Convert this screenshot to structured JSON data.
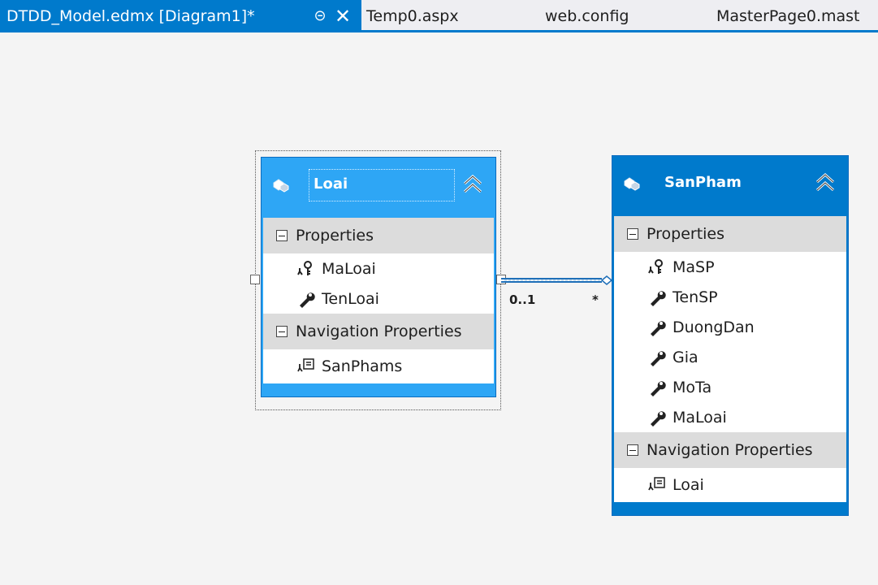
{
  "tabs": [
    {
      "label": "DTDD_Model.edmx [Diagram1]*",
      "active": true
    },
    {
      "label": "Temp0.aspx",
      "active": false
    },
    {
      "label": "web.config",
      "active": false
    },
    {
      "label": "MasterPage0.mast",
      "active": false
    }
  ],
  "tab_icons": {
    "pin": "pin-icon",
    "close": "close-icon"
  },
  "entities": {
    "loai": {
      "title": "Loai",
      "properties_header": "Properties",
      "properties": [
        {
          "name": "MaLoai",
          "icon": "key-property-icon"
        },
        {
          "name": "TenLoai",
          "icon": "property-wrench-icon"
        }
      ],
      "nav_header": "Navigation Properties",
      "nav_properties": [
        {
          "name": "SanPhams",
          "icon": "navigation-property-icon"
        }
      ]
    },
    "sanpham": {
      "title": "SanPham",
      "properties_header": "Properties",
      "properties": [
        {
          "name": "MaSP",
          "icon": "key-property-icon"
        },
        {
          "name": "TenSP",
          "icon": "property-wrench-icon"
        },
        {
          "name": "DuongDan",
          "icon": "property-wrench-icon"
        },
        {
          "name": "Gia",
          "icon": "property-wrench-icon"
        },
        {
          "name": "MoTa",
          "icon": "property-wrench-icon"
        },
        {
          "name": "MaLoai",
          "icon": "property-wrench-icon"
        }
      ],
      "nav_header": "Navigation Properties",
      "nav_properties": [
        {
          "name": "Loai",
          "icon": "navigation-property-icon"
        }
      ]
    }
  },
  "association": {
    "left_multiplicity": "0..1",
    "right_multiplicity": "*"
  },
  "colors": {
    "accent": "#007acc",
    "selected_entity": "#2ea6f5",
    "section_bg": "#dcdcdc",
    "canvas_bg": "#f4f4f4"
  }
}
